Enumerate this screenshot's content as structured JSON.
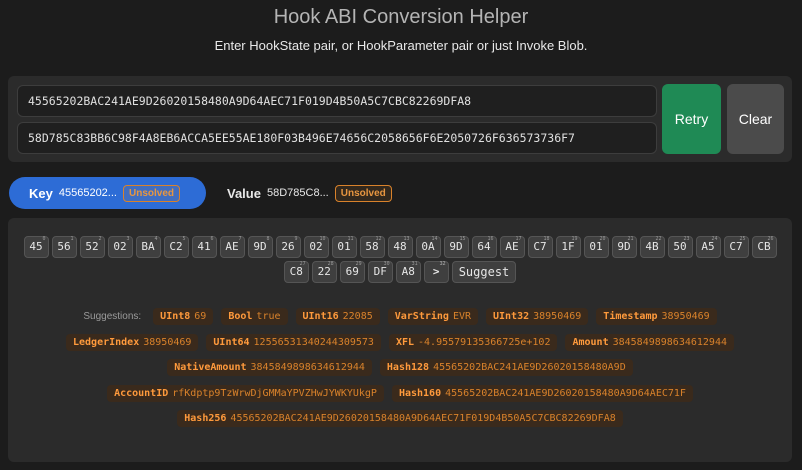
{
  "header": {
    "title": "Hook ABI Conversion Helper",
    "subtitle": "Enter HookState pair, or HookParameter pair or just Invoke Blob."
  },
  "inputs": {
    "key_hex": "45565202BAC241AE9D26020158480A9D64AEC71F019D4B50A5C7CBC82269DFA8",
    "value_hex": "58D785C83BB6C98F4A8EB6ACCA5EE55AE180F03B496E74656C2058656F6E2050726F636573736F7"
  },
  "buttons": {
    "retry": "Retry",
    "clear": "Clear"
  },
  "tabs": [
    {
      "name": "Key",
      "preview": "45565202...",
      "status": "Unsolved",
      "active": true
    },
    {
      "name": "Value",
      "preview": "58D785C8...",
      "status": "Unsolved",
      "active": false
    }
  ],
  "bytes": [
    {
      "v": "45",
      "i": "0"
    },
    {
      "v": "56",
      "i": "1"
    },
    {
      "v": "52",
      "i": "2"
    },
    {
      "v": "02",
      "i": "3"
    },
    {
      "v": "BA",
      "i": "4"
    },
    {
      "v": "C2",
      "i": "5"
    },
    {
      "v": "41",
      "i": "6"
    },
    {
      "v": "AE",
      "i": "7"
    },
    {
      "v": "9D",
      "i": "8"
    },
    {
      "v": "26",
      "i": "9"
    },
    {
      "v": "02",
      "i": "10"
    },
    {
      "v": "01",
      "i": "11"
    },
    {
      "v": "58",
      "i": "12"
    },
    {
      "v": "48",
      "i": "13"
    },
    {
      "v": "0A",
      "i": "14"
    },
    {
      "v": "9D",
      "i": "15"
    },
    {
      "v": "64",
      "i": "16"
    },
    {
      "v": "AE",
      "i": "17"
    },
    {
      "v": "C7",
      "i": "18"
    },
    {
      "v": "1F",
      "i": "19"
    },
    {
      "v": "01",
      "i": "20"
    },
    {
      "v": "9D",
      "i": "21"
    },
    {
      "v": "4B",
      "i": "22"
    },
    {
      "v": "50",
      "i": "23"
    },
    {
      "v": "A5",
      "i": "24"
    },
    {
      "v": "C7",
      "i": "25"
    },
    {
      "v": "CB",
      "i": "26"
    },
    {
      "v": "C8",
      "i": "27"
    },
    {
      "v": "22",
      "i": "28"
    },
    {
      "v": "69",
      "i": "29"
    },
    {
      "v": "DF",
      "i": "30"
    },
    {
      "v": "A8",
      "i": "31"
    }
  ],
  "next_byte": {
    "v": ">",
    "i": "32"
  },
  "suggest_label": "Suggest",
  "suggestions_label": "Suggestions:",
  "suggestion_rows": [
    [
      {
        "type": "UInt8",
        "value": "69"
      },
      {
        "type": "Bool",
        "value": "true"
      },
      {
        "type": "UInt16",
        "value": "22085"
      },
      {
        "type": "VarString",
        "value": "EVR"
      },
      {
        "type": "UInt32",
        "value": "38950469"
      },
      {
        "type": "Timestamp",
        "value": "38950469"
      }
    ],
    [
      {
        "type": "LedgerIndex",
        "value": "38950469"
      },
      {
        "type": "UInt64",
        "value": "12556531340244309573"
      },
      {
        "type": "XFL",
        "value": "-4.95579135366725e+102"
      },
      {
        "type": "Amount",
        "value": "3845849898634612944"
      }
    ],
    [
      {
        "type": "NativeAmount",
        "value": "3845849898634612944"
      },
      {
        "type": "Hash128",
        "value": "45565202BAC241AE9D26020158480A9D"
      }
    ],
    [
      {
        "type": "AccountID",
        "value": "rfKdptp9TzWrwDjGMMaYPVZHwJYWKYUkgP"
      },
      {
        "type": "Hash160",
        "value": "45565202BAC241AE9D26020158480A9D64AEC71F"
      }
    ],
    [
      {
        "type": "Hash256",
        "value": "45565202BAC241AE9D26020158480A9D64AEC71F019D4B50A5C7CBC82269DFA8"
      }
    ]
  ]
}
